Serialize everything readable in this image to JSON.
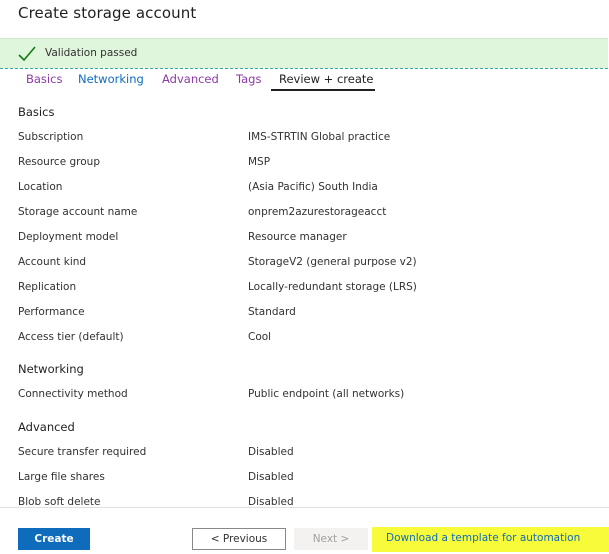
{
  "page": {
    "title": "Create storage account"
  },
  "validation": {
    "message": "Validation passed",
    "color": "#dff6dd"
  },
  "tabs": [
    {
      "label": "Basics"
    },
    {
      "label": "Networking"
    },
    {
      "label": "Advanced"
    },
    {
      "label": "Tags"
    },
    {
      "label": "Review + create"
    }
  ],
  "sections": {
    "basics": {
      "title": "Basics",
      "rows": [
        {
          "label": "Subscription",
          "value": "IMS-STRTIN Global practice"
        },
        {
          "label": "Resource group",
          "value": "MSP"
        },
        {
          "label": "Location",
          "value": "(Asia Pacific) South India"
        },
        {
          "label": "Storage account name",
          "value": "onprem2azurestorageacct"
        },
        {
          "label": "Deployment model",
          "value": "Resource manager"
        },
        {
          "label": "Account kind",
          "value": "StorageV2 (general purpose v2)"
        },
        {
          "label": "Replication",
          "value": "Locally-redundant storage (LRS)"
        },
        {
          "label": "Performance",
          "value": "Standard"
        },
        {
          "label": "Access tier (default)",
          "value": "Cool"
        }
      ]
    },
    "networking": {
      "title": "Networking",
      "rows": [
        {
          "label": "Connectivity method",
          "value": "Public endpoint (all networks)"
        }
      ]
    },
    "advanced": {
      "title": "Advanced",
      "rows": [
        {
          "label": "Secure transfer required",
          "value": "Disabled"
        },
        {
          "label": "Large file shares",
          "value": "Disabled"
        },
        {
          "label": "Blob soft delete",
          "value": "Disabled"
        }
      ]
    }
  },
  "footer": {
    "create_label": "Create",
    "previous_label": "< Previous",
    "next_label": "Next >",
    "download_label": "Download a template for automation"
  },
  "colors": {
    "accent": "#0f6cbd",
    "highlight": "#f8fb3a",
    "success": "#107c10"
  }
}
